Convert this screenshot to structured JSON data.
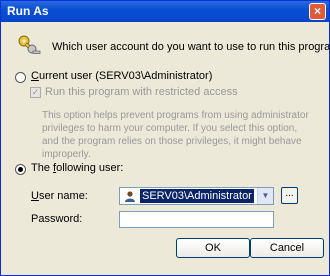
{
  "window": {
    "title": "Run As"
  },
  "prompt": "Which user account do you want to use to run this program?",
  "current_user": {
    "prefix": "C",
    "label_rest": "urrent user (SERV03\\Administrator)",
    "selected": false
  },
  "restricted": {
    "label": "Run this program with restricted access",
    "checked": true,
    "enabled": false,
    "help_text": "This option helps prevent programs from using administrator privileges to harm your computer. If you select this option, and the program relies on those privileges, it might behave improperly."
  },
  "following_user": {
    "prefix": "The ",
    "underlined": "f",
    "label_rest": "ollowing user:",
    "selected": true
  },
  "fields": {
    "user_name_label_underlined": "U",
    "user_name_label_rest": "ser name:",
    "user_name_value": "SERV03\\Administrator",
    "browse_label": "...",
    "password_label": "Password:",
    "password_value": ""
  },
  "buttons": {
    "ok": "OK",
    "cancel": "Cancel"
  },
  "icons": {
    "title_close": "close-icon",
    "keys": "keys-icon",
    "user": "user-icon",
    "dropdown": "chevron-down-icon"
  }
}
